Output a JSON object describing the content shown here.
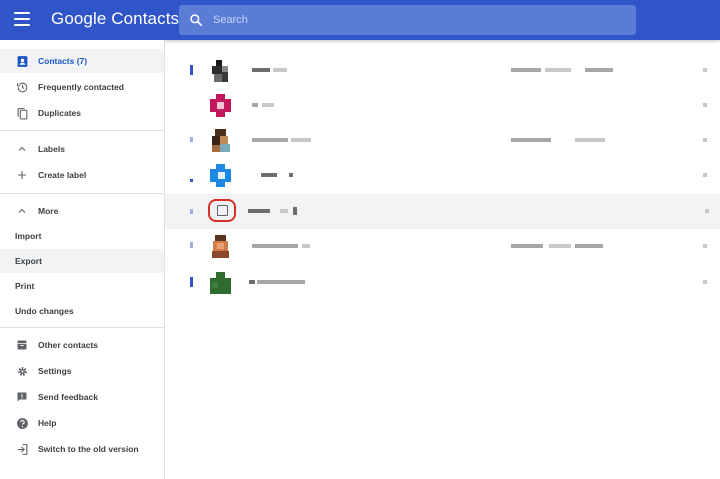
{
  "header": {
    "title": "Google Contacts",
    "menu_icon": "hamburger-menu-icon",
    "search": {
      "icon": "search-icon",
      "placeholder": "Search"
    }
  },
  "sidebar": {
    "items": [
      {
        "label": "Contacts (7)",
        "icon": "contacts-icon",
        "active": true
      },
      {
        "label": "Frequently contacted",
        "icon": "history-icon"
      },
      {
        "label": "Duplicates",
        "icon": "duplicates-icon"
      },
      {
        "label": "Labels",
        "icon": "chevron-up-icon"
      },
      {
        "label": "Create label",
        "icon": "plus-icon"
      },
      {
        "label": "More",
        "icon": "chevron-up-icon"
      },
      {
        "label": "Import"
      },
      {
        "label": "Export",
        "hover": true
      },
      {
        "label": "Print"
      },
      {
        "label": "Undo changes"
      },
      {
        "label": "Other contacts",
        "icon": "archive-icon"
      },
      {
        "label": "Settings",
        "icon": "gear-icon"
      },
      {
        "label": "Send feedback",
        "icon": "feedback-icon"
      },
      {
        "label": "Help",
        "icon": "help-icon"
      },
      {
        "label": "Switch to the old version",
        "icon": "exit-icon"
      }
    ]
  },
  "contacts": {
    "count": 7,
    "selected_row": 5,
    "selected_control": "checkbox",
    "colors": {
      "header": "#2f55c8",
      "active_text": "#1a56c4",
      "highlight_ring": "#d93025",
      "avatar_pink": "#c2185b",
      "avatar_blue": "#1e88e5",
      "avatar_green": "#2e6b2e"
    }
  }
}
